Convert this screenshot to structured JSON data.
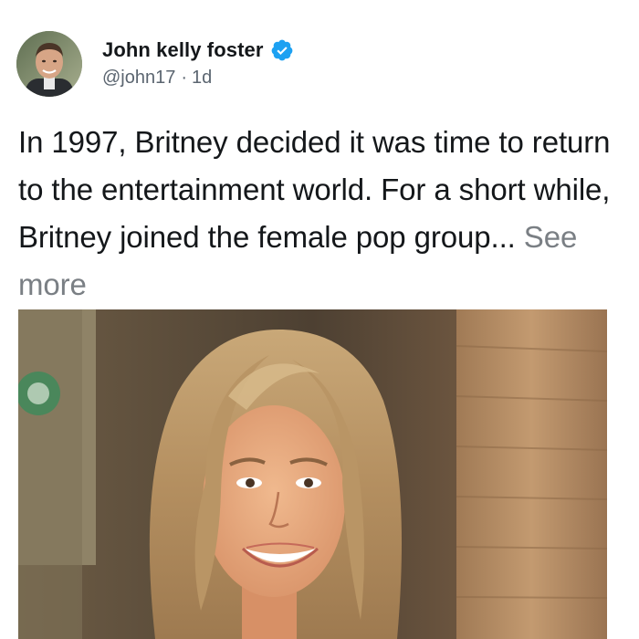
{
  "author": {
    "display_name": "John kelly foster",
    "handle": "@john17",
    "separator": "·",
    "time_ago": "1d",
    "verified": true
  },
  "post": {
    "text": "In 1997, Britney decided it was time to return to the entertainment world. For a short while, Britney joined the female pop group...",
    "see_more_label": "See more"
  },
  "colors": {
    "verified_badge": "#1da1f2",
    "see_more": "#7a7f84",
    "text": "#14171a",
    "meta": "#5b6570"
  },
  "icons": {
    "verified": "verified-badge-icon"
  }
}
